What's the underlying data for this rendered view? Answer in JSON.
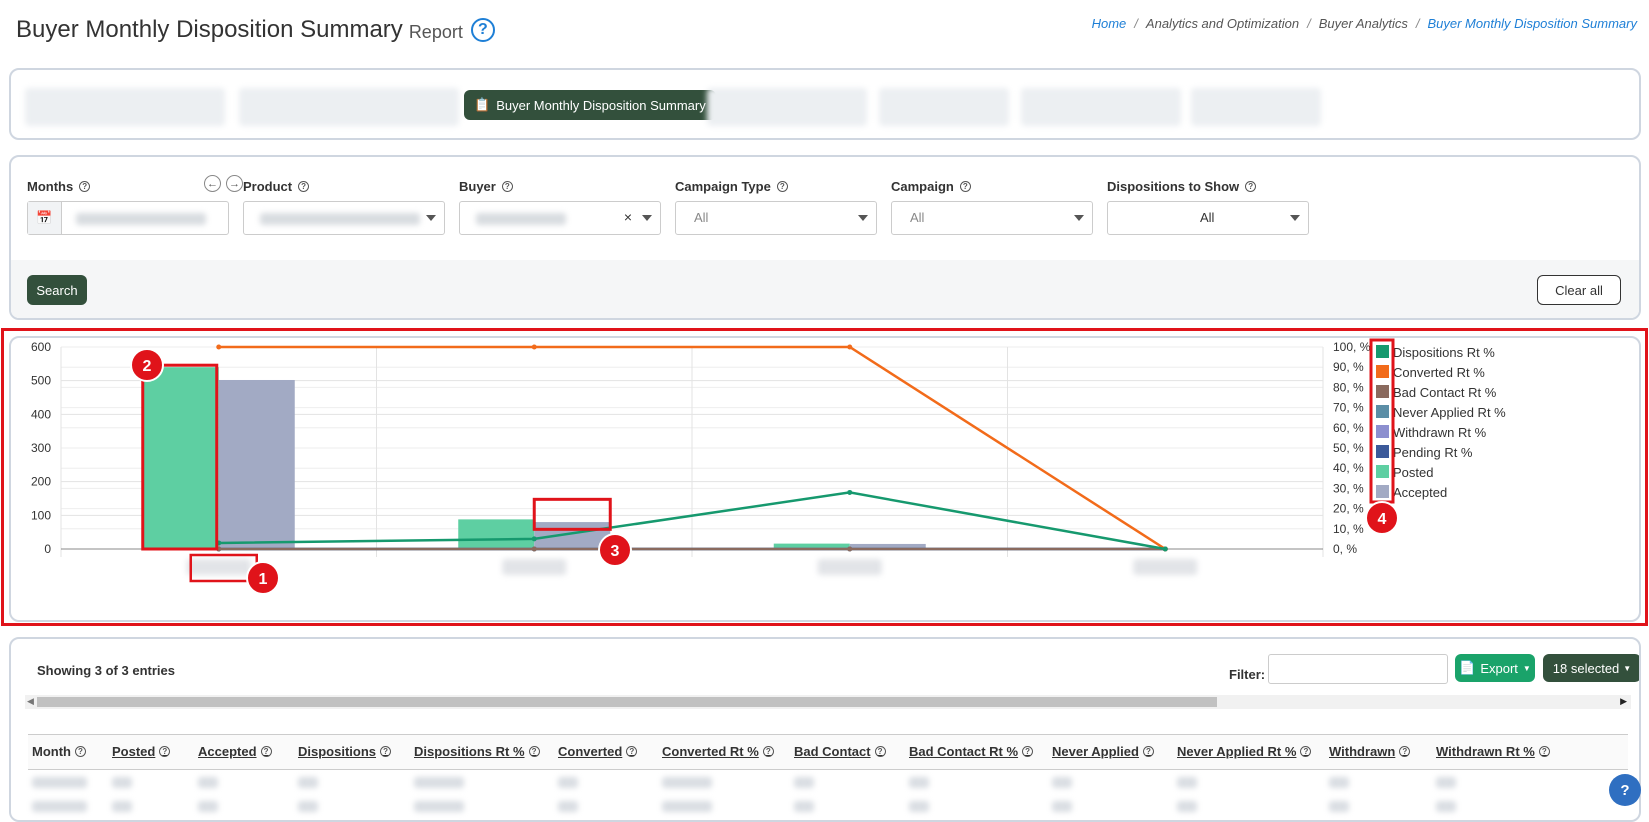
{
  "header": {
    "title": "Buyer Monthly Disposition Summary",
    "subtitle": "Report",
    "help_glyph": "?",
    "breadcrumb": [
      "Home",
      "Analytics and Optimization",
      "Buyer Analytics",
      "Buyer Monthly Disposition Summary"
    ]
  },
  "tabs": {
    "active_label": "Buyer Monthly Disposition Summary"
  },
  "filters": {
    "months_label": "Months",
    "product_label": "Product",
    "buyer_label": "Buyer",
    "campaign_type_label": "Campaign Type",
    "campaign_type_value": "All",
    "campaign_label": "Campaign",
    "campaign_value": "All",
    "dispositions_label": "Dispositions to Show",
    "dispositions_value": "All",
    "buyer_clear_glyph": "×",
    "search_label": "Search",
    "clear_label": "Clear all"
  },
  "chart_data": {
    "type": "bar",
    "categories": [
      "",
      "",
      "",
      ""
    ],
    "series": [
      {
        "name": "Posted",
        "axis": "left",
        "kind": "bar",
        "color": "#5ecfa2",
        "values": [
          540,
          88,
          16,
          0
        ]
      },
      {
        "name": "Accepted",
        "axis": "left",
        "kind": "bar",
        "color": "#a2aac4",
        "values": [
          502,
          80,
          15,
          0
        ]
      },
      {
        "name": "Dispositions Rt %",
        "axis": "right",
        "kind": "line",
        "color": "#16996e",
        "values": [
          3,
          5,
          28,
          0
        ]
      },
      {
        "name": "Converted Rt %",
        "axis": "right",
        "kind": "line",
        "color": "#f26b1a",
        "values": [
          100,
          100,
          100,
          0
        ]
      },
      {
        "name": "Bad Contact Rt %",
        "axis": "right",
        "kind": "line",
        "color": "#8a6a5e",
        "values": [
          0,
          0,
          0,
          0
        ]
      },
      {
        "name": "Never Applied Rt %",
        "axis": "right",
        "kind": "line",
        "color": "#5b8ea6",
        "values": [
          0,
          0,
          0,
          0
        ]
      },
      {
        "name": "Withdrawn Rt %",
        "axis": "right",
        "kind": "line",
        "color": "#8c8fcf",
        "values": [
          0,
          0,
          0,
          0
        ]
      },
      {
        "name": "Pending Rt %",
        "axis": "right",
        "kind": "line",
        "color": "#3c5a9a",
        "values": [
          0,
          0,
          0,
          0
        ]
      }
    ],
    "legend": [
      "Dispositions Rt %",
      "Converted Rt %",
      "Bad Contact Rt %",
      "Never Applied Rt %",
      "Withdrawn Rt %",
      "Pending Rt %",
      "Posted",
      "Accepted"
    ],
    "legend_colors": [
      "#16996e",
      "#f26b1a",
      "#8a6a5e",
      "#5b8ea6",
      "#8c8fcf",
      "#3c5a9a",
      "#5ecfa2",
      "#a2aac4"
    ],
    "left_ticks": [
      "600",
      "500",
      "400",
      "300",
      "200",
      "100",
      "0"
    ],
    "right_ticks": [
      "100, %",
      "90, %",
      "80, %",
      "70, %",
      "60, %",
      "50, %",
      "40, %",
      "30, %",
      "20, %",
      "10, %",
      "0, %"
    ],
    "ylim_left": [
      0,
      600
    ],
    "ylim_right": [
      0,
      100
    ],
    "legend_position": "right",
    "grid": true,
    "annotations": [
      "1",
      "2",
      "3",
      "4"
    ]
  },
  "table": {
    "showing": "Showing 3 of 3 entries",
    "filter_label": "Filter:",
    "export_label": "Export",
    "selected_label": "18 selected",
    "columns": [
      "Month",
      "Posted",
      "Accepted",
      "Dispositions",
      "Dispositions Rt %",
      "Converted",
      "Converted Rt %",
      "Bad Contact",
      "Bad Contact Rt %",
      "Never Applied",
      "Never Applied Rt %",
      "Withdrawn",
      "Withdrawn Rt %"
    ]
  }
}
